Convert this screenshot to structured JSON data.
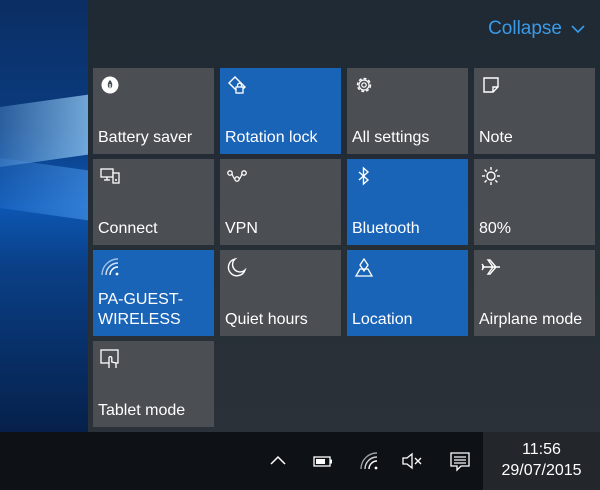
{
  "header": {
    "collapse_label": "Collapse"
  },
  "tiles": [
    {
      "label": "Battery saver",
      "icon": "battery-saver-icon",
      "active": false
    },
    {
      "label": "Rotation lock",
      "icon": "rotation-lock-icon",
      "active": true
    },
    {
      "label": "All settings",
      "icon": "gear-icon",
      "active": false
    },
    {
      "label": "Note",
      "icon": "note-icon",
      "active": false
    },
    {
      "label": "Connect",
      "icon": "connect-icon",
      "active": false
    },
    {
      "label": "VPN",
      "icon": "vpn-icon",
      "active": false
    },
    {
      "label": "Bluetooth",
      "icon": "bluetooth-icon",
      "active": true
    },
    {
      "label": "80%",
      "icon": "brightness-icon",
      "active": false
    },
    {
      "label": "PA-GUEST-\nWIRELESS",
      "icon": "wifi-icon",
      "active": true
    },
    {
      "label": "Quiet hours",
      "icon": "moon-icon",
      "active": false
    },
    {
      "label": "Location",
      "icon": "location-icon",
      "active": true
    },
    {
      "label": "Airplane mode",
      "icon": "airplane-icon",
      "active": false
    },
    {
      "label": "Tablet mode",
      "icon": "tablet-mode-icon",
      "active": false
    }
  ],
  "taskbar": {
    "time": "11:56",
    "date": "29/07/2015"
  },
  "colors": {
    "accent": "#1a64b8",
    "tile": "#4b4f53",
    "link": "#3a9ae8"
  }
}
